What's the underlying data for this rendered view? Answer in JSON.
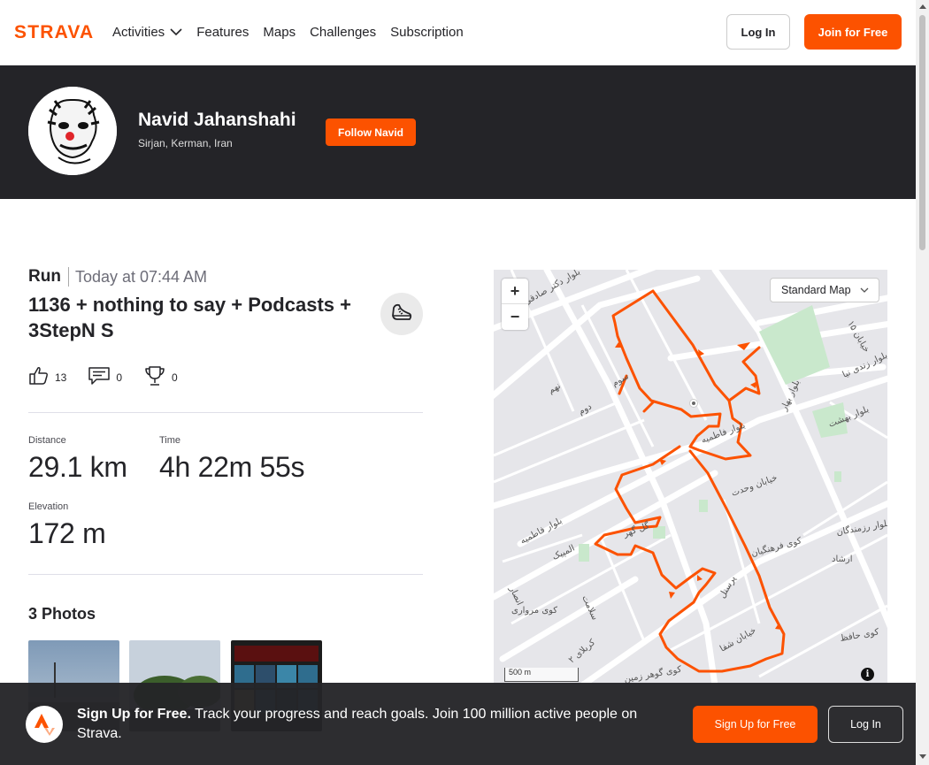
{
  "nav": {
    "brand": "STRAVA",
    "items": [
      {
        "label": "Activities",
        "has_dropdown": true
      },
      {
        "label": "Features"
      },
      {
        "label": "Maps"
      },
      {
        "label": "Challenges"
      },
      {
        "label": "Subscription"
      }
    ],
    "login_label": "Log In",
    "join_label": "Join for Free"
  },
  "athlete": {
    "name": "Navid Jahanshahi",
    "location": "Sirjan, Kerman, Iran",
    "follow_label": "Follow Navid"
  },
  "activity": {
    "type": "Run",
    "date": "Today at 07:44 AM",
    "title": "1136 + nothing to say + Podcasts + 3StepN S",
    "kudos": "13",
    "comments": "0",
    "achievements": "0",
    "stats": [
      {
        "label": "Distance",
        "value": "29.1 km"
      },
      {
        "label": "Time",
        "value": "4h 22m 55s"
      },
      {
        "label": "Elevation",
        "value": "172 m"
      }
    ],
    "photos_title": "3 Photos"
  },
  "map": {
    "style_label": "Standard Map",
    "scale_label": "500 m",
    "info_glyph": "i",
    "route_color": "#fc5200",
    "street_labels": [
      "بلوار دکتر صادقی",
      "نهم",
      "دوم",
      "سوم",
      "بلوار فاطمیه",
      "بلوار فاطمیه",
      "خیابان وحدت",
      "کوی فرهنگیان",
      "ارشاد",
      "المپیک",
      "انصار",
      "سلامت",
      "کوی مرواری",
      "کربلای ۲",
      "کوی گوهر زمین",
      "خیابان شفا",
      "کوی حافظ",
      "بلوار رزمندگان",
      "بلوار بهشت",
      "بلوار بهار",
      "بلوار زندی نیا",
      "خیابان ۱۵",
      "گل گهر",
      "پرسنل"
    ]
  },
  "banner": {
    "bold_text": "Sign Up for Free.",
    "text": " Track your progress and reach goals. Join 100 million active people on Strava.",
    "signup_label": "Sign Up for Free",
    "login_label": "Log In"
  },
  "colors": {
    "brand": "#fc5200",
    "header_band": "#242428"
  }
}
